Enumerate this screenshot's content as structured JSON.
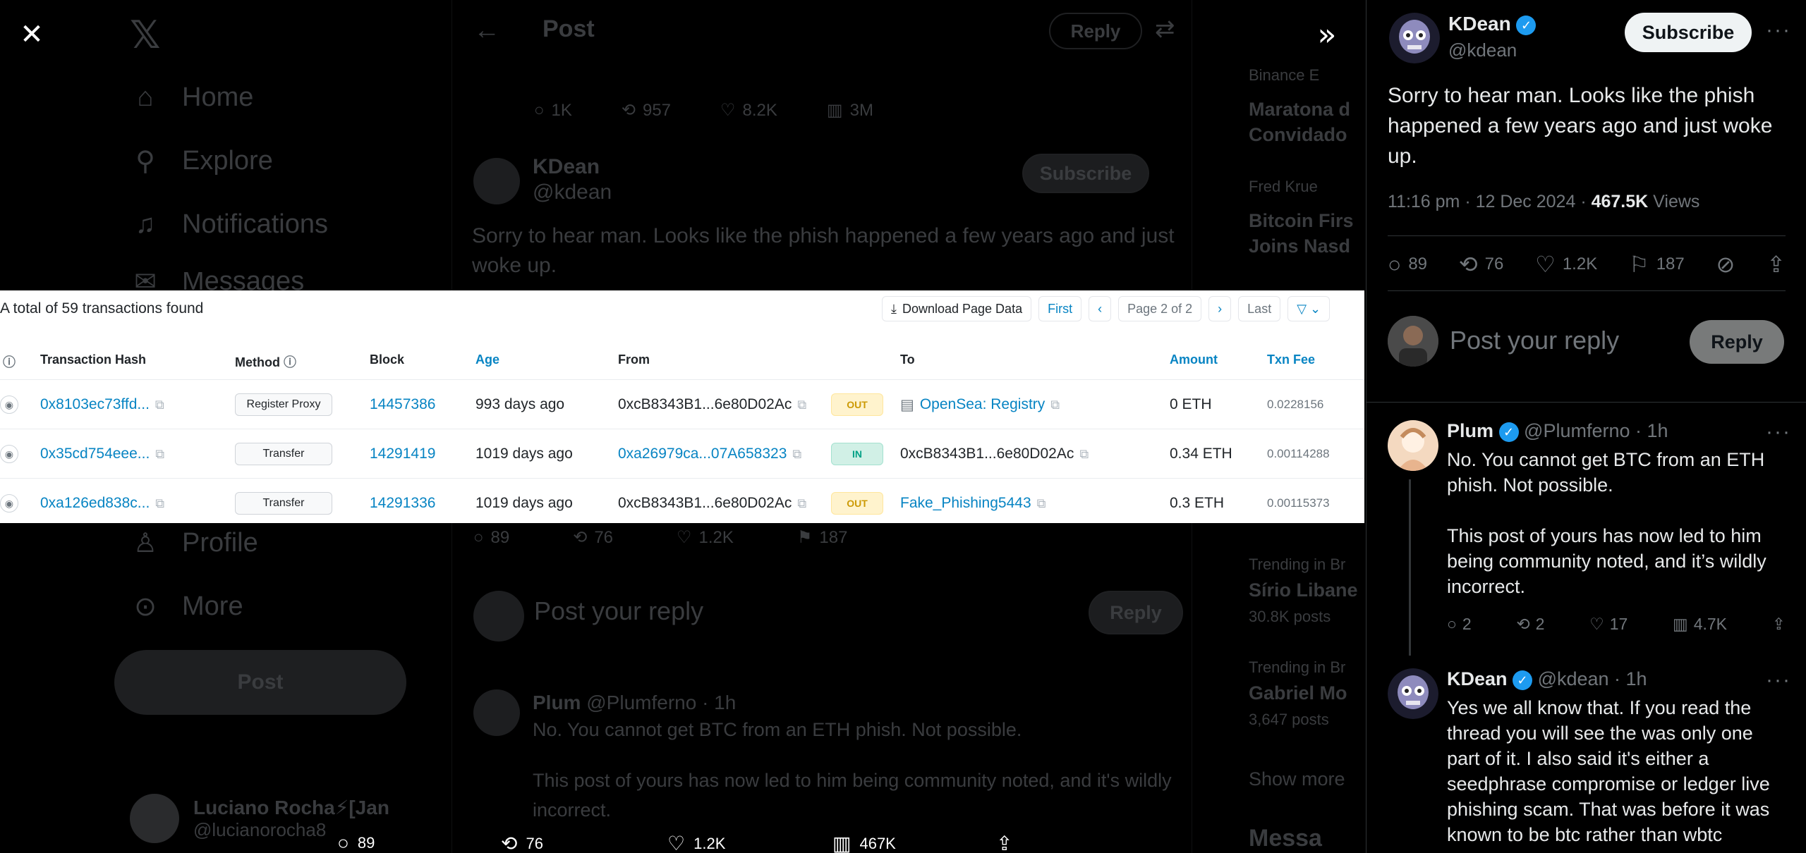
{
  "nav": {
    "items": [
      "Home",
      "Explore",
      "Notifications",
      "Messages",
      "Profile",
      "More"
    ],
    "post_label": "Post",
    "user_name": "Luciano Rocha⚡[Jan",
    "user_handle": "@lucianorocha8"
  },
  "center": {
    "header_title": "Post",
    "header_reply": "Reply",
    "prev_actions": {
      "replies": "1K",
      "reposts": "957",
      "likes": "8.2K",
      "views": "3M"
    },
    "author_name": "KDean",
    "author_handle": "@kdean",
    "subscribe": "Subscribe",
    "text": "Sorry to hear man. Looks like the phish happened a few years ago and just woke up.",
    "actions": {
      "replies": "89",
      "reposts": "76",
      "likes": "1.2K",
      "bookmarks": "187"
    },
    "reply_placeholder": "Post your reply",
    "reply_button": "Reply",
    "comment_name": "Plum",
    "comment_handle": "@Plumferno · 1h",
    "comment_line1": "No. You cannot get BTC from an ETH phish. Not possible.",
    "comment_line2": "This post of yours has now led to him being community noted, and it's wildly incorrect."
  },
  "sidebar": {
    "items": [
      {
        "small": "Binance E",
        "title": "Maratona d",
        "title2": "Convidado"
      },
      {
        "small": "Fred Krue",
        "title": "Bitcoin Firs",
        "title2": "Joins Nasd"
      },
      {
        "small": "Trending in Br",
        "title": "Sírio Libane",
        "title2": "30.8K posts"
      },
      {
        "small": "Trending in Br",
        "title": "Gabriel Mo",
        "title2": "3,647 posts"
      }
    ],
    "show_more": "Show more",
    "messages": "Messa"
  },
  "media": {
    "total": "A total of 59 transactions found",
    "toolbar": {
      "download": "Download Page Data",
      "first": "First",
      "prev": "‹",
      "page": "Page 2 of 2",
      "next": "›",
      "last": "Last",
      "filter": "▽ ⌄"
    },
    "columns": [
      "Transaction Hash",
      "Method",
      "Block",
      "Age",
      "From",
      "To",
      "Amount",
      "Txn Fee"
    ],
    "rows": [
      {
        "hash": "0x8103ec73ffd...",
        "method": "Register Proxy",
        "block": "14457386",
        "age": "993 days ago",
        "from": "0xcB8343B1...6e80D02Ac",
        "dir": "OUT",
        "to": "OpenSea: Registry",
        "amount": "0 ETH",
        "fee": "0.0228156"
      },
      {
        "hash": "0x35cd754eee...",
        "method": "Transfer",
        "block": "14291419",
        "age": "1019 days ago",
        "from": "0xa26979ca...07A658323",
        "dir": "IN",
        "to": "0xcB8343B1...6e80D02Ac",
        "amount": "0.34 ETH",
        "fee": "0.00114288"
      },
      {
        "hash": "0xa126ed838c...",
        "method": "Transfer",
        "block": "14291336",
        "age": "1019 days ago",
        "from": "0xcB8343B1...6e80D02Ac",
        "dir": "OUT",
        "to": "Fake_Phishing5443",
        "amount": "0.3 ETH",
        "fee": "0.00115373"
      }
    ]
  },
  "media_bar": {
    "replies": "89",
    "reposts": "76",
    "likes": "1.2K",
    "views": "467K"
  },
  "panel": {
    "author_name": "KDean",
    "author_handle": "@kdean",
    "subscribe": "Subscribe",
    "text": "Sorry to hear man. Looks like the phish happened a few years ago and just woke up.",
    "time": "11:16 pm · 12 Dec 2024 · ",
    "views_count": "467.5K",
    "views_label": " Views",
    "actions": {
      "replies": "89",
      "reposts": "76",
      "likes": "1.2K",
      "bookmarks": "187"
    },
    "reply_placeholder": "Post your reply",
    "reply_button": "Reply",
    "comments": [
      {
        "name": "Plum",
        "handle": "@Plumferno · 1h",
        "text1": "No. You cannot get BTC from an ETH phish. Not possible.",
        "text2": "This post of yours has now led to him being community noted, and it’s wildly incorrect.",
        "replies": "2",
        "reposts": "2",
        "likes": "17",
        "views": "4.7K"
      },
      {
        "name": "KDean",
        "handle": "@kdean · 1h",
        "text1": "Yes we all know that. If you read the thread you will see the was only one part of it. I also said it's either a seedphrase compromise or ledger live phishing scam. That was before it was known to be btc rather than wbtc"
      }
    ]
  },
  "colors": {
    "accent": "#1d9bf0",
    "link": "#0784c3",
    "muted": "#71767b"
  }
}
